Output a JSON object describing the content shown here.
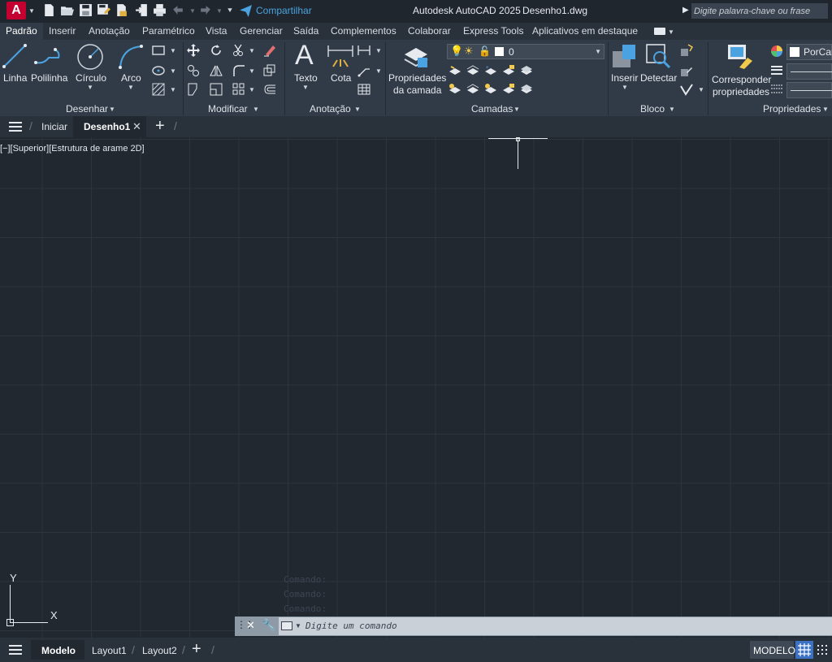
{
  "app": {
    "title": "Autodesk AutoCAD 2025",
    "document": "Desenho1.dwg",
    "logo_letter": "A",
    "share_label": "Compartilhar",
    "search_placeholder": "Digite palavra-chave ou frase"
  },
  "ribbon_tabs": [
    "Padrão",
    "Inserir",
    "Anotação",
    "Paramétrico",
    "Vista",
    "Gerenciar",
    "Saída",
    "Complementos",
    "Colaborar",
    "Express Tools",
    "Aplicativos em destaque"
  ],
  "ribbon": {
    "draw": {
      "panel_label": "Desenhar",
      "line": "Linha",
      "polyline": "Polilinha",
      "circle": "Círculo",
      "arc": "Arco"
    },
    "modify": {
      "panel_label": "Modificar"
    },
    "annotation": {
      "panel_label": "Anotação",
      "text": "Texto",
      "dimension": "Cota"
    },
    "layers": {
      "panel_label": "Camadas",
      "properties_line1": "Propriedades",
      "properties_line2": "da camada",
      "current_layer": "0"
    },
    "block": {
      "panel_label": "Bloco",
      "insert": "Inserir",
      "detect": "Detectar"
    },
    "properties": {
      "panel_label": "Propriedades",
      "match_line1": "Corresponder",
      "match_line2": "propriedades",
      "color_value": "PorCar"
    }
  },
  "file_tabs": {
    "start": "Iniciar",
    "active": "Desenho1"
  },
  "viewport": {
    "label": "[−][Superior][Estrutura de arame 2D]",
    "ucs_y": "Y",
    "ucs_x": "X"
  },
  "command": {
    "history": [
      "Comando:",
      "Comando:",
      "Comando:"
    ],
    "placeholder": "Digite um comando"
  },
  "layout_tabs": [
    "Modelo",
    "Layout1",
    "Layout2"
  ],
  "status": {
    "model": "MODELO"
  },
  "colors": {
    "accent": "#c3002f",
    "share_blue": "#4aa3e0",
    "ribbon_bg": "#313b47",
    "canvas_bg": "#212830",
    "grid_button": "#3b72c4"
  }
}
